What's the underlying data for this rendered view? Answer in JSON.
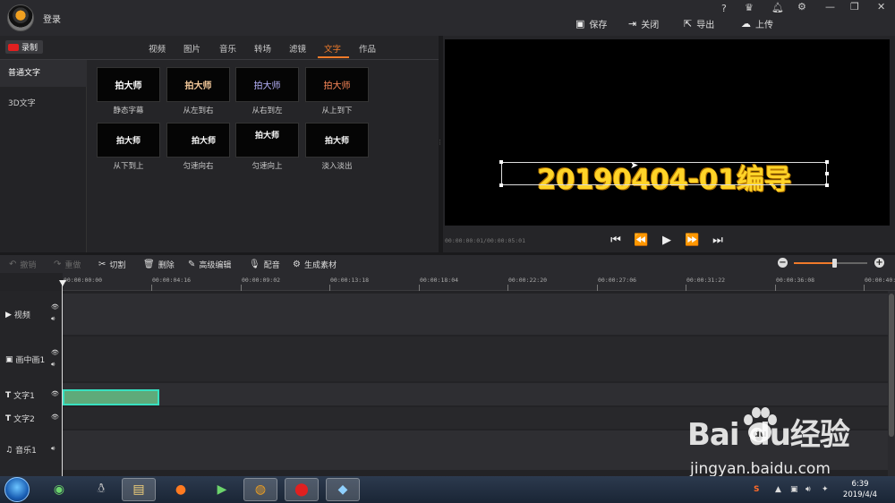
{
  "header": {
    "login": "登录",
    "help": "?",
    "actions": [
      {
        "icon": "save-icon",
        "label": "保存"
      },
      {
        "icon": "exit-icon",
        "label": "关闭"
      },
      {
        "icon": "export-icon",
        "label": "导出"
      },
      {
        "icon": "upload-icon",
        "label": "上传"
      }
    ]
  },
  "library": {
    "record_label": "录制",
    "tabs": [
      "视频",
      "图片",
      "音乐",
      "转场",
      "滤镜",
      "文字",
      "作品"
    ],
    "active_tab": "文字",
    "subnav": [
      "普通文字",
      "3D文字"
    ],
    "thumbnails": [
      {
        "text": "拍大师",
        "label": "静态字幕",
        "color": "#ffffff"
      },
      {
        "text": "拍大师",
        "label": "从左到右",
        "color": "#f4c99a"
      },
      {
        "text": "拍大师",
        "label": "从右到左",
        "color": "#b9b4ff"
      },
      {
        "text": "拍大师",
        "label": "从上到下",
        "color": "#ff8a5a"
      },
      {
        "text": "拍大师",
        "label": "从下到上",
        "color": "#ffffff"
      },
      {
        "text": "拍大师",
        "label": "匀速向右",
        "color": "#ffffff"
      },
      {
        "text": "拍大师",
        "label": "匀速向上",
        "color": "#ffffff"
      },
      {
        "text": "拍大师",
        "label": "淡入淡出",
        "color": "#ffffff"
      }
    ]
  },
  "preview": {
    "caption": "20190404-01编导",
    "timecode": "00:00:00:01/00:00:05:01"
  },
  "editbar": {
    "undo": "撤销",
    "redo": "重做",
    "cut": "切割",
    "delete": "删除",
    "advanced": "高级编辑",
    "dub": "配音",
    "generate": "生成素材",
    "zoom_level": 0.56
  },
  "timeline": {
    "ticks": [
      "00:00:00:00",
      "00:00:04:16",
      "00:00:09:02",
      "00:00:13:18",
      "00:00:18:04",
      "00:00:22:20",
      "00:00:27:06",
      "00:00:31:22",
      "00:00:36:08",
      "00:00:40:"
    ],
    "tracks": [
      {
        "icon": "video-icon",
        "label": "视频"
      },
      {
        "icon": "pip-icon",
        "label": "画中画1"
      },
      {
        "icon": "text-track-icon",
        "label": "文字1"
      },
      {
        "icon": "text-track-icon",
        "label": "文字2"
      },
      {
        "icon": "music-icon",
        "label": "音乐1"
      }
    ]
  },
  "taskbar": {
    "time": "6:39",
    "date": "2019/4/4"
  },
  "watermark": {
    "brand": "Bai du经验",
    "url": "jingyan.baidu.com"
  },
  "colors": {
    "accent": "#f07a2a",
    "caption": "#ffd428",
    "clip": "#5faa7a"
  }
}
